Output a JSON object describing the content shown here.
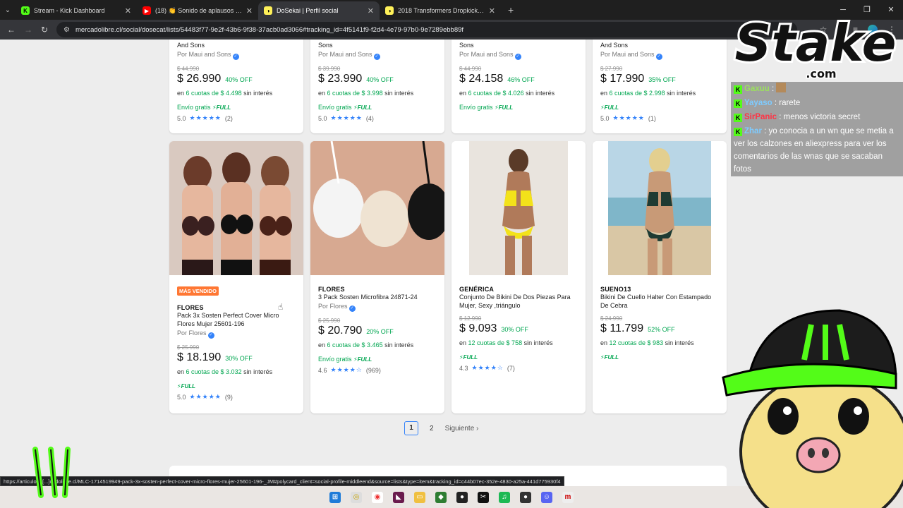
{
  "browser": {
    "tabs": [
      {
        "title": "Stream - Kick Dashboard",
        "active": false,
        "fav_color": "#53fc18"
      },
      {
        "title": "(18) 👏 Sonido de aplausos y g",
        "active": false,
        "fav_color": "#ff0000"
      },
      {
        "title": "DoSekai | Perfil social",
        "active": true,
        "fav_color": "#fff159"
      },
      {
        "title": "2018 Transformers Dropkick De",
        "active": false,
        "fav_color": "#fff159"
      }
    ],
    "url": "mercadolibre.cl/social/dosecat/lists/54483f77-9e2f-43b6-9f38-37acb0ad3066#tracking_id=4f5141f9-f2d4-4e79-97b0-9e7289ebb89f",
    "status_url": "https://articulo.m[...]cadolibre.cl/MLC-1714519949-pack-3x-sosten-perfect-cover-micro-flores-mujer-25601-196-_JM#polycard_client=social-profile-middleend&source=lists&type=item&tracking_id=c44b07ec-352e-4830-a25a-441d775930f4"
  },
  "top_row": [
    {
      "title_tail": "And Sons",
      "seller": "Por Maui and Sons",
      "old_price": "$ 44.990",
      "price": "$ 26.990",
      "off": "40% OFF",
      "cuotas_n": "6 cuotas de $ 4.498",
      "cuotas_suffix": " sin interés",
      "envio": "Envío gratis",
      "full": "FULL",
      "rating": "5.0",
      "reviews": "(2)"
    },
    {
      "title_tail": "Sons",
      "seller": "Por Maui and Sons",
      "old_price": "$ 39.990",
      "price": "$ 23.990",
      "off": "40% OFF",
      "cuotas_n": "6 cuotas de $ 3.998",
      "cuotas_suffix": " sin interés",
      "envio": "Envío gratis",
      "full": "FULL",
      "rating": "5.0",
      "reviews": "(4)"
    },
    {
      "title_tail": "Sons",
      "seller": "Por Maui and Sons",
      "old_price": "$ 44.990",
      "price": "$ 24.158",
      "off": "46% OFF",
      "cuotas_n": "6 cuotas de $ 4.026",
      "cuotas_suffix": " sin interés",
      "envio": "Envío gratis",
      "full": "FULL",
      "rating": "",
      "reviews": ""
    },
    {
      "title_tail": "And Sons",
      "seller": "Por Maui and Sons",
      "old_price": "$ 27.990",
      "price": "$ 17.990",
      "off": "35% OFF",
      "cuotas_n": "6 cuotas de $ 2.998",
      "cuotas_suffix": " sin interés",
      "envio": "",
      "full": "FULL",
      "rating": "5.0",
      "reviews": "(1)"
    }
  ],
  "products": [
    {
      "badge": "MÁS VENDIDO",
      "brand": "FLORES",
      "title": "Pack 3x Sosten Perfect Cover Micro Flores Mujer 25601-196",
      "seller": "Por Flores",
      "old_price": "$ 25.990",
      "price": "$ 18.190",
      "off": "30% OFF",
      "cuotas_n": "6 cuotas de $ 3.032",
      "cuotas_suffix": " sin interés",
      "envio": "",
      "full": "FULL",
      "rating": "5.0",
      "reviews": "(9)"
    },
    {
      "badge": "",
      "brand": "FLORES",
      "title": "3 Pack Sosten Microfibra 24871-24",
      "seller": "Por Flores",
      "old_price": "$ 25.990",
      "price": "$ 20.790",
      "off": "20% OFF",
      "cuotas_n": "6 cuotas de $ 3.465",
      "cuotas_suffix": " sin interés",
      "envio": "Envío gratis",
      "full": "FULL",
      "rating": "4.6",
      "reviews": "(969)"
    },
    {
      "badge": "",
      "brand": "GENÉRICA",
      "title": "Conjunto De Bikini De Dos Piezas Para Mujer, Sexy ,triángulo",
      "seller": "",
      "old_price": "$ 12.990",
      "price": "$ 9.093",
      "off": "30% OFF",
      "cuotas_n": "12 cuotas de $ 758",
      "cuotas_suffix": " sin interés",
      "envio": "",
      "full": "FULL",
      "rating": "4.3",
      "reviews": "(7)"
    },
    {
      "badge": "",
      "brand": "SUENO13",
      "title": "Bikini De Cuello Halter Con Estampado De Cebra",
      "seller": "",
      "old_price": "$ 24.990",
      "price": "$ 11.799",
      "off": "52% OFF",
      "cuotas_n": "12 cuotas de $ 983",
      "cuotas_suffix": " sin interés",
      "envio": "",
      "full": "FULL",
      "rating": "",
      "reviews": ""
    }
  ],
  "pager": {
    "current": "1",
    "page2": "2",
    "next": "Siguiente"
  },
  "overlay": {
    "sponsor": "Stake",
    "sponsor_sub": ".com",
    "chat": [
      {
        "user": "Gaxuu",
        "text": ""
      },
      {
        "user": "Yayaso",
        "text": "rarete"
      },
      {
        "user": "SirPanic",
        "text": "menos victoria secret"
      },
      {
        "user": "Zhar",
        "text": "yo conocia a un wn que se metia a ver los calzones en aliexpress para ver los comentarios de las wnas que se sacaban fotos"
      }
    ]
  },
  "colors": {
    "mercado_green": "#00a650",
    "mercado_blue": "#3483fa",
    "kick_green": "#53fc18",
    "badge_orange": "#ff7733"
  }
}
